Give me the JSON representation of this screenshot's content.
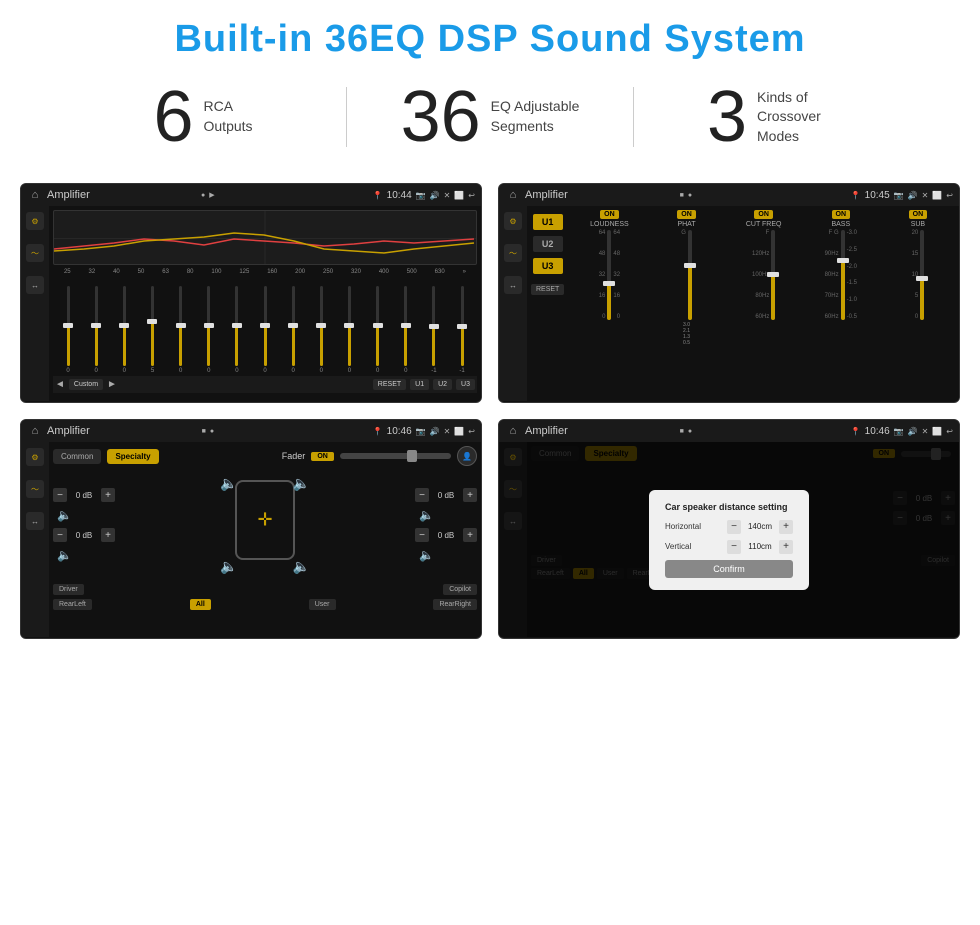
{
  "header": {
    "title": "Built-in 36EQ DSP Sound System"
  },
  "stats": [
    {
      "number": "6",
      "label": "RCA\nOutputs"
    },
    {
      "number": "36",
      "label": "EQ Adjustable\nSegments"
    },
    {
      "number": "3",
      "label": "Kinds of\nCrossover Modes"
    }
  ],
  "screens": {
    "eq": {
      "title": "Amplifier",
      "time": "10:44",
      "freq_labels": [
        "25",
        "32",
        "40",
        "50",
        "63",
        "80",
        "100",
        "125",
        "160",
        "200",
        "250",
        "320",
        "400",
        "500",
        "630"
      ],
      "slider_values": [
        "0",
        "0",
        "0",
        "5",
        "0",
        "0",
        "0",
        "0",
        "0",
        "0",
        "0",
        "0",
        "0",
        "-1",
        "-1"
      ],
      "bottom_buttons": [
        "◄",
        "Custom",
        "►",
        "RESET",
        "U1",
        "U2",
        "U3"
      ]
    },
    "crossover": {
      "title": "Amplifier",
      "time": "10:45",
      "u_buttons": [
        "U1",
        "U2",
        "U3"
      ],
      "columns": [
        "LOUDNESS",
        "PHAT",
        "CUT FREQ",
        "BASS",
        "SUB"
      ],
      "reset_label": "RESET"
    },
    "fader": {
      "title": "Amplifier",
      "time": "10:46",
      "tabs": [
        "Common",
        "Specialty"
      ],
      "fader_label": "Fader",
      "on_label": "ON",
      "vol_labels": [
        "0 dB",
        "0 dB",
        "0 dB",
        "0 dB"
      ],
      "bottom_buttons": [
        "Driver",
        "Copilot",
        "RearLeft",
        "All",
        "User",
        "RearRight"
      ]
    },
    "distance": {
      "title": "Amplifier",
      "time": "10:46",
      "tabs": [
        "Common",
        "Specialty"
      ],
      "on_label": "ON",
      "dialog": {
        "title": "Car speaker distance setting",
        "horizontal_label": "Horizontal",
        "horizontal_value": "140cm",
        "vertical_label": "Vertical",
        "vertical_value": "110cm",
        "confirm_label": "Confirm"
      },
      "right_values": [
        "0 dB",
        "0 dB"
      ],
      "bottom_buttons": [
        "Driver",
        "Copilot",
        "RearLeft",
        "All",
        "User",
        "RearRight"
      ]
    }
  }
}
